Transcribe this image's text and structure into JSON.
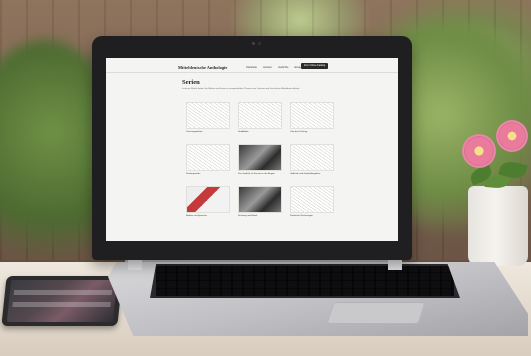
{
  "website": {
    "brand": "Mitteldeutsche Anthologie",
    "nav": [
      "Startseite",
      "Autoren",
      "Gedichte",
      "Essays",
      "Begleitmaterial"
    ],
    "nav_button": "Zum Online-Katalog",
    "page_title": "Serien",
    "intro": "In dieser Rubrik finden Sie Reihen und Serien zu ausgewählten Themen aus Literatur und Geschichte Mitteldeutschlands.",
    "series": [
      {
        "title": "Taschengedichte",
        "thumb": "sketch"
      },
      {
        "title": "Stadtbilder",
        "thumb": "sketch"
      },
      {
        "title": "Orte der Dichtung",
        "thumb": "sketch"
      },
      {
        "title": "Dichterporträts",
        "thumb": "sketch"
      },
      {
        "title": "Das Gedicht als Fenster in die Region",
        "thumb": "photo"
      },
      {
        "title": "Gedichte und Gedichtbeigaben",
        "thumb": "sketch"
      },
      {
        "title": "Redner und Sprecher",
        "thumb": "color"
      },
      {
        "title": "Dichtung und Musik",
        "thumb": "photo"
      },
      {
        "title": "Poetische Zeichnungen",
        "thumb": "sketch"
      }
    ]
  },
  "colors": {
    "screen_bg": "#f4f4f2",
    "laptop_lid": "#1f1f22",
    "flower": "#e97b9c",
    "foliage": "#6e8c45"
  }
}
